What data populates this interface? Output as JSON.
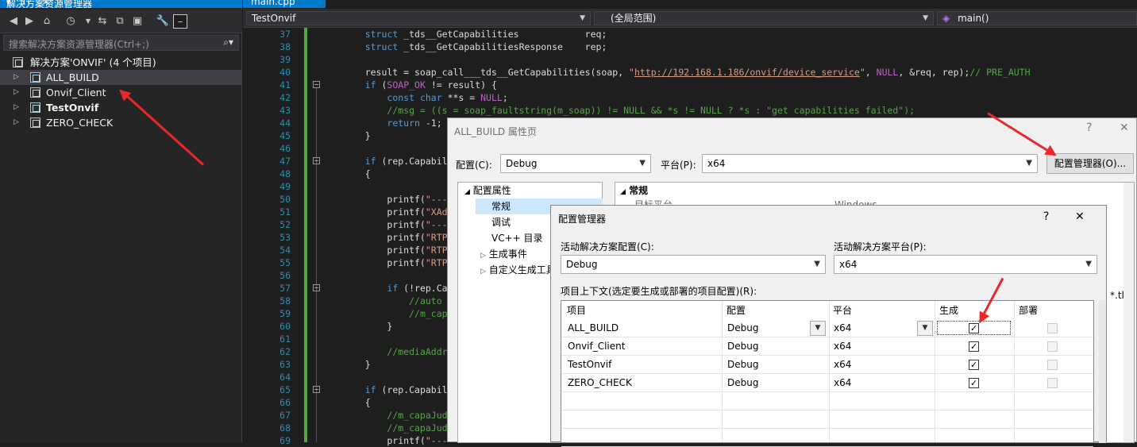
{
  "solution_explorer": {
    "title": "解决方案资源管理器",
    "title_buttons": "▾ ⊓ ✕",
    "search_placeholder": "搜索解决方案资源管理器(Ctrl+;)",
    "solution_label": "解决方案'ONVIF' (4 个项目)",
    "projects": [
      {
        "label": "ALL_BUILD",
        "bold": false,
        "selected": true
      },
      {
        "label": "Onvif_Client",
        "bold": false,
        "selected": false
      },
      {
        "label": "TestOnvif",
        "bold": true,
        "selected": false
      },
      {
        "label": "ZERO_CHECK",
        "bold": false,
        "selected": false
      }
    ]
  },
  "editor": {
    "tab_label": "main.cpp",
    "nav_project": "TestOnvif",
    "nav_scope": "(全局范围)",
    "nav_function": "main()",
    "lines": [
      {
        "n": "37",
        "t": "    struct _tds__GetCapabilities            req;"
      },
      {
        "n": "38",
        "t": "    struct _tds__GetCapabilitiesResponse    rep;"
      },
      {
        "n": "39",
        "t": ""
      },
      {
        "n": "40",
        "t": "    result = soap_call___tds__GetCapabilities(soap, \"http://192.168.1.186/onvif/device_service\", NULL, &req, rep);// PRE_AUTH"
      },
      {
        "n": "41",
        "t": "    if (SOAP_OK != result) {"
      },
      {
        "n": "42",
        "t": "        const char **s = NULL;"
      },
      {
        "n": "43",
        "t": "        //msg = ((s = soap_faultstring(m_soap)) != NULL && *s != NULL ? *s : \"get capabilities failed\");"
      },
      {
        "n": "44",
        "t": "        return -1;"
      },
      {
        "n": "45",
        "t": "    }"
      },
      {
        "n": "46",
        "t": ""
      },
      {
        "n": "47",
        "t": "    if (rep.Capabilitie"
      },
      {
        "n": "48",
        "t": "    {"
      },
      {
        "n": "49",
        "t": ""
      },
      {
        "n": "50",
        "t": "        printf(\"-------"
      },
      {
        "n": "51",
        "t": "        printf(\"XAddr:%"
      },
      {
        "n": "52",
        "t": "        printf(\"-------"
      },
      {
        "n": "53",
        "t": "        printf(\"RTPMult"
      },
      {
        "n": "54",
        "t": "        printf(\"RTP_TCP"
      },
      {
        "n": "55",
        "t": "        printf(\"RTP_RTS"
      },
      {
        "n": "56",
        "t": ""
      },
      {
        "n": "57",
        "t": "        if (!rep.Capabi"
      },
      {
        "n": "58",
        "t": "            //auto pair"
      },
      {
        "n": "59",
        "t": "            //m_capaAdd"
      },
      {
        "n": "60",
        "t": "        }"
      },
      {
        "n": "61",
        "t": ""
      },
      {
        "n": "62",
        "t": "        //mediaAddr = r"
      },
      {
        "n": "63",
        "t": "    }"
      },
      {
        "n": "64",
        "t": ""
      },
      {
        "n": "65",
        "t": "    if (rep.Capabilitie"
      },
      {
        "n": "66",
        "t": "    {"
      },
      {
        "n": "67",
        "t": "        //m_capaJudge.i"
      },
      {
        "n": "68",
        "t": "        //m_capaJudge[F"
      },
      {
        "n": "69",
        "t": "        printf(\"-------"
      }
    ]
  },
  "property_pages": {
    "title": "ALL_BUILD 属性页",
    "help": "?",
    "close": "✕",
    "config_label": "配置(C):",
    "config_value": "Debug",
    "platform_label": "平台(P):",
    "platform_value": "x64",
    "config_manager_button": "配置管理器(O)...",
    "tree": [
      {
        "label": "配置属性",
        "indent": 0,
        "expander": "◢"
      },
      {
        "label": "常规",
        "indent": 1,
        "expander": "",
        "selected": true
      },
      {
        "label": "调试",
        "indent": 1,
        "expander": ""
      },
      {
        "label": "VC++ 目录",
        "indent": 1,
        "expander": ""
      },
      {
        "label": "生成事件",
        "indent": 1,
        "expander": "▷"
      },
      {
        "label": "自定义生成工具",
        "indent": 1,
        "expander": "▷"
      }
    ],
    "grid_section": "常规",
    "grid_row1_name": "目标平台",
    "grid_row1_value": "Windows",
    "grid_trunc_text": "*.tl"
  },
  "config_manager": {
    "title": "配置管理器",
    "help": "?",
    "close": "✕",
    "active_config_label": "活动解决方案配置(C):",
    "active_config_value": "Debug",
    "active_platform_label": "活动解决方案平台(P):",
    "active_platform_value": "x64",
    "contexts_label": "项目上下文(选定要生成或部署的项目配置)(R):",
    "columns": [
      "项目",
      "配置",
      "平台",
      "生成",
      "部署"
    ],
    "rows": [
      {
        "project": "ALL_BUILD",
        "config": "Debug",
        "platform": "x64",
        "build": true,
        "deploy": false
      },
      {
        "project": "Onvif_Client",
        "config": "Debug",
        "platform": "x64",
        "build": true,
        "deploy": false
      },
      {
        "project": "TestOnvif",
        "config": "Debug",
        "platform": "x64",
        "build": true,
        "deploy": false
      },
      {
        "project": "ZERO_CHECK",
        "config": "Debug",
        "platform": "x64",
        "build": true,
        "deploy": false
      }
    ]
  },
  "colors": {
    "accent": "#007acc",
    "annotation_arrow": "#e8282a"
  }
}
